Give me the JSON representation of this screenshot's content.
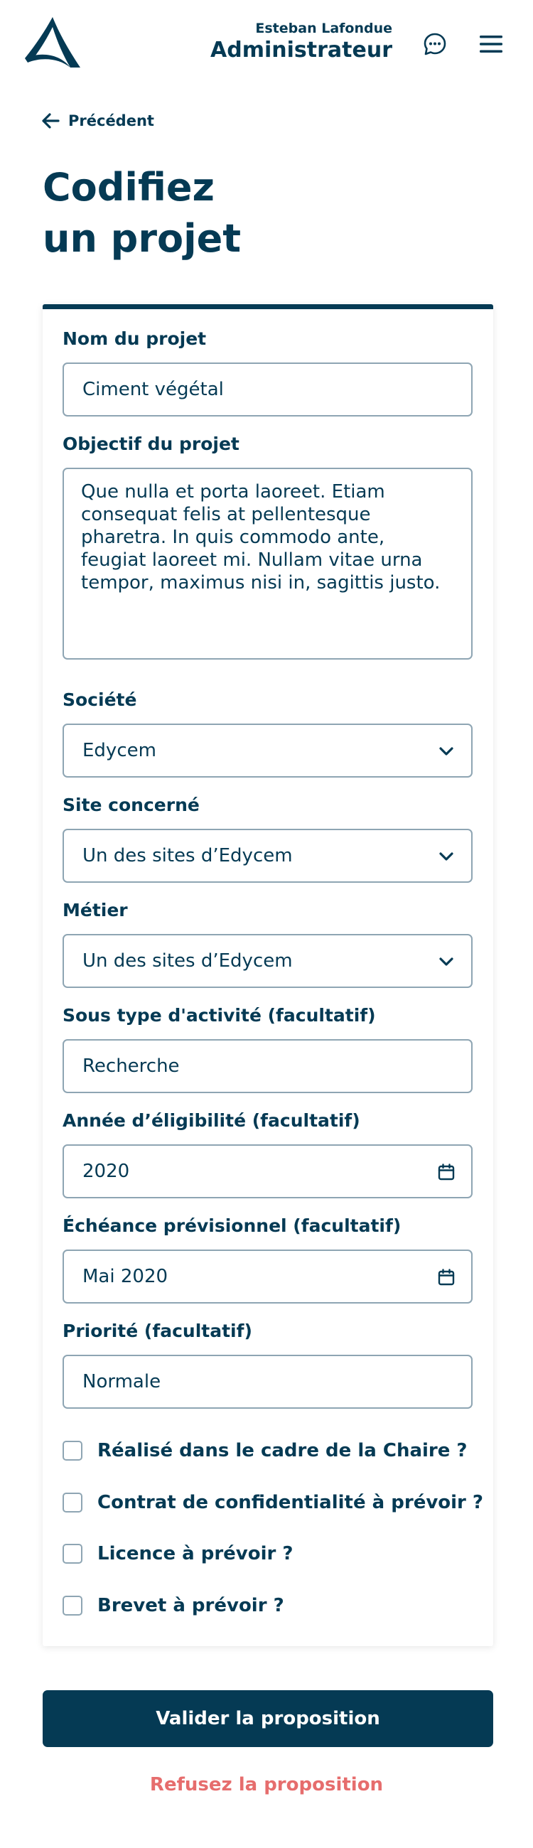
{
  "colors": {
    "primary": "#053a54",
    "border": "#8ea5b3",
    "danger": "#e66d6d"
  },
  "header": {
    "user_name": "Esteban Lafondue",
    "user_role": "Administrateur",
    "icons": {
      "logo": "triangle-logo",
      "chat": "chat-bubble-icon",
      "menu": "hamburger-menu-icon"
    }
  },
  "back_label": "Précédent",
  "title": {
    "line1": "Codifiez",
    "line2": "un projet"
  },
  "form": {
    "nom": {
      "label": "Nom du projet",
      "value": "Ciment végétal"
    },
    "objectif": {
      "label": "Objectif du projet",
      "value": "Que nulla et porta laoreet. Etiam consequat felis at pellentesque pharetra. In quis commodo ante, feugiat laoreet mi. Nullam vitae urna tempor, maximus nisi in, sagittis justo."
    },
    "societe": {
      "label": "Société",
      "value": "Edycem"
    },
    "site": {
      "label": "Site concerné",
      "value": "Un des sites d’Edycem"
    },
    "metier": {
      "label": "Métier",
      "value": "Un des sites d’Edycem"
    },
    "sous_type": {
      "label": "Sous type d'activité (facultatif)",
      "value": "Recherche"
    },
    "annee": {
      "label": "Année d’éligibilité (facultatif)",
      "value": "2020"
    },
    "echeance": {
      "label": "Échéance prévisionnel (facultatif)",
      "value": "Mai 2020"
    },
    "priorite": {
      "label": "Priorité (facultatif)",
      "value": "Normale"
    },
    "checkboxes": [
      {
        "label": "Réalisé dans le cadre de la Chaire ?",
        "checked": false
      },
      {
        "label": "Contrat de confidentialité à prévoir ?",
        "checked": false
      },
      {
        "label": "Licence à prévoir ?",
        "checked": false
      },
      {
        "label": "Brevet à prévoir ?",
        "checked": false
      }
    ]
  },
  "actions": {
    "submit": "Valider la proposition",
    "refuse": "Refusez la proposition"
  }
}
